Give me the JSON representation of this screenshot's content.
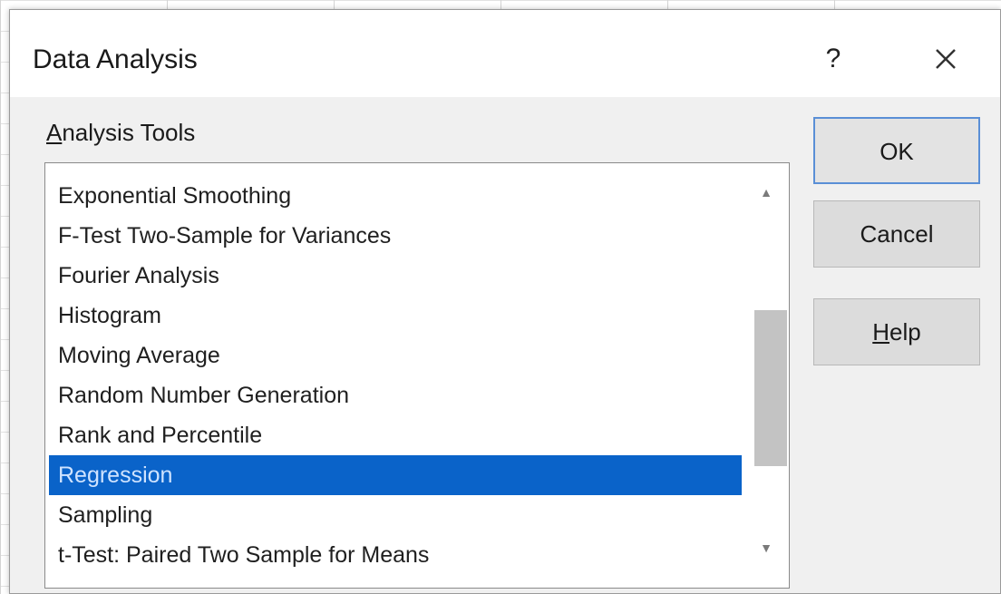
{
  "dialog": {
    "title": "Data Analysis",
    "help_glyph": "?",
    "close_icon": "close-icon"
  },
  "tools": {
    "label_underlined": "A",
    "label_rest": "nalysis Tools",
    "items": [
      {
        "label": "Exponential Smoothing",
        "selected": false
      },
      {
        "label": "F-Test Two-Sample for Variances",
        "selected": false
      },
      {
        "label": "Fourier Analysis",
        "selected": false
      },
      {
        "label": "Histogram",
        "selected": false
      },
      {
        "label": "Moving Average",
        "selected": false
      },
      {
        "label": "Random Number Generation",
        "selected": false
      },
      {
        "label": "Rank and Percentile",
        "selected": false
      },
      {
        "label": "Regression",
        "selected": true
      },
      {
        "label": "Sampling",
        "selected": false
      },
      {
        "label": "t-Test: Paired Two Sample for Means",
        "selected": false
      }
    ],
    "scroll_up_glyph": "▲",
    "scroll_down_glyph": "▼"
  },
  "buttons": {
    "ok": "OK",
    "cancel": "Cancel",
    "help_underlined": "H",
    "help_rest": "elp"
  },
  "colors": {
    "selection": "#0a63c9",
    "default_button_border": "#5a8fd6"
  }
}
